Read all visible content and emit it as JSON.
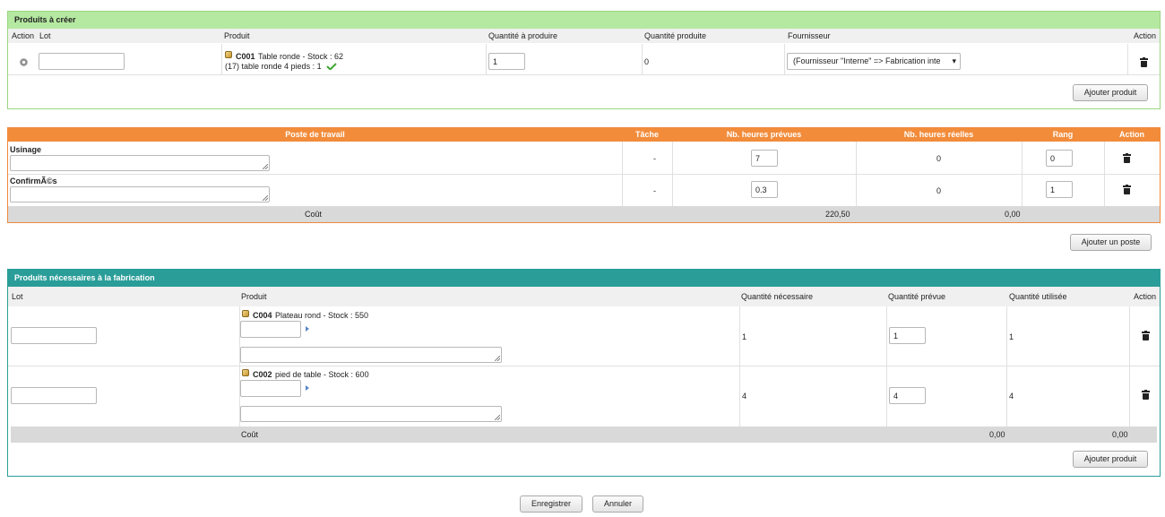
{
  "to_create": {
    "title": "Produits à créer",
    "headers": {
      "action_left": "Action",
      "lot": "Lot",
      "produit": "Produit",
      "qte_produire": "Quantité à produire",
      "qte_produite": "Quantité produite",
      "fournisseur": "Fournisseur",
      "action_right": "Action"
    },
    "row": {
      "lot_value": "",
      "product_ref": "C001",
      "product_desc": "Table ronde - Stock : 62",
      "product_line2": "(17) table ronde 4 pieds : 1",
      "qty_to_produce": "1",
      "qty_produced": "0",
      "supplier_selected": "(Fournisseur \"Interne\" => Fabrication inte"
    },
    "add_button": "Ajouter produit"
  },
  "workstations": {
    "headers": {
      "poste": "Poste de travail",
      "tache": "Tâche",
      "heures_prevues": "Nb. heures prévues",
      "heures_reelles": "Nb. heures réelles",
      "rang": "Rang",
      "action": "Action"
    },
    "rows": [
      {
        "name": "Usinage",
        "tache": "-",
        "heures_prevues": "7",
        "heures_reelles": "0",
        "rang": "0"
      },
      {
        "name": "ConfirmÃ©s",
        "tache": "-",
        "heures_prevues": "0.3",
        "heures_reelles": "0",
        "rang": "1"
      }
    ],
    "footer": {
      "label": "Coût",
      "total_prevu": "220,50",
      "total_reel": "0,00"
    },
    "add_button": "Ajouter un poste"
  },
  "needed": {
    "title": "Produits nécessaires à la fabrication",
    "headers": {
      "lot": "Lot",
      "produit": "Produit",
      "qte_necessaire": "Quantité nécessaire",
      "qte_prevue": "Quantité prévue",
      "qte_utilisee": "Quantité utilisée",
      "action": "Action"
    },
    "rows": [
      {
        "ref": "C004",
        "desc": "Plateau rond - Stock : 550",
        "qte_necessaire": "1",
        "qte_prevue": "1",
        "qte_utilisee": "1"
      },
      {
        "ref": "C002",
        "desc": "pied de table - Stock : 600",
        "qte_necessaire": "4",
        "qte_prevue": "4",
        "qte_utilisee": "4"
      }
    ],
    "footer": {
      "label": "Coût",
      "total_prevu": "0,00",
      "total_utilise": "0,00"
    },
    "add_button": "Ajouter produit"
  },
  "form_buttons": {
    "save": "Enregistrer",
    "cancel": "Annuler"
  }
}
